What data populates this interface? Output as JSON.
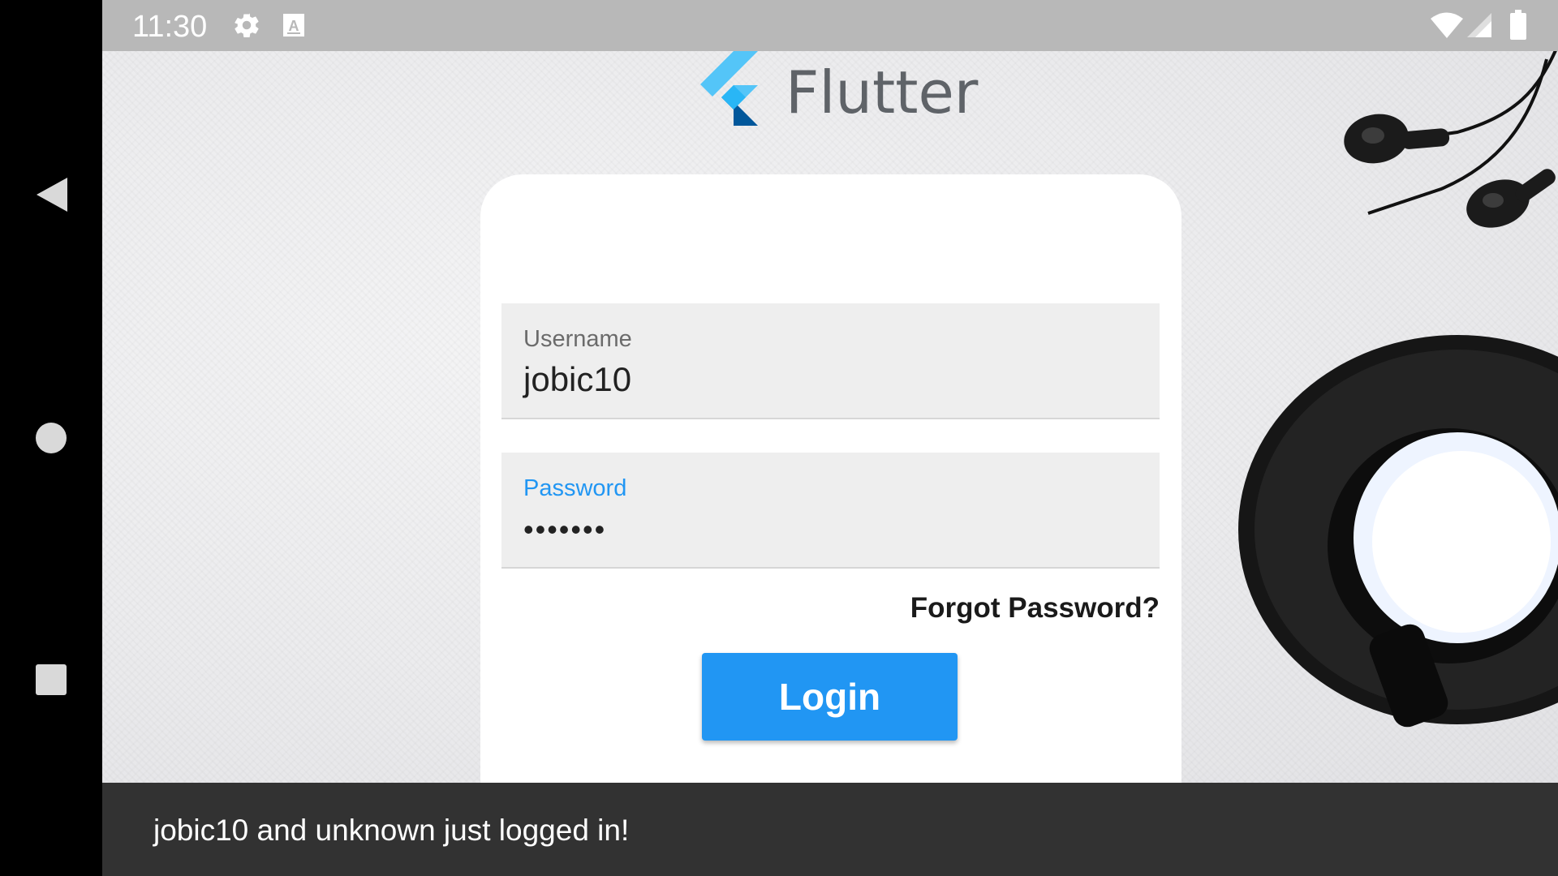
{
  "status_bar": {
    "time": "11:30",
    "icons": [
      "settings-icon",
      "keyboard-a-icon",
      "wifi-icon",
      "signal-icon",
      "battery-icon"
    ]
  },
  "app": {
    "logo_text": "Flutter",
    "username": {
      "label": "Username",
      "value": "jobic10"
    },
    "password": {
      "label": "Password",
      "value": "•••••••"
    },
    "forgot_password": "Forgot Password?",
    "login_button": "Login",
    "accent_color": "#2196f3"
  },
  "snackbar": {
    "message": "jobic10 and unknown just logged in!"
  },
  "nav_bar": {
    "buttons": [
      "back-icon",
      "home-icon",
      "recents-icon"
    ]
  }
}
